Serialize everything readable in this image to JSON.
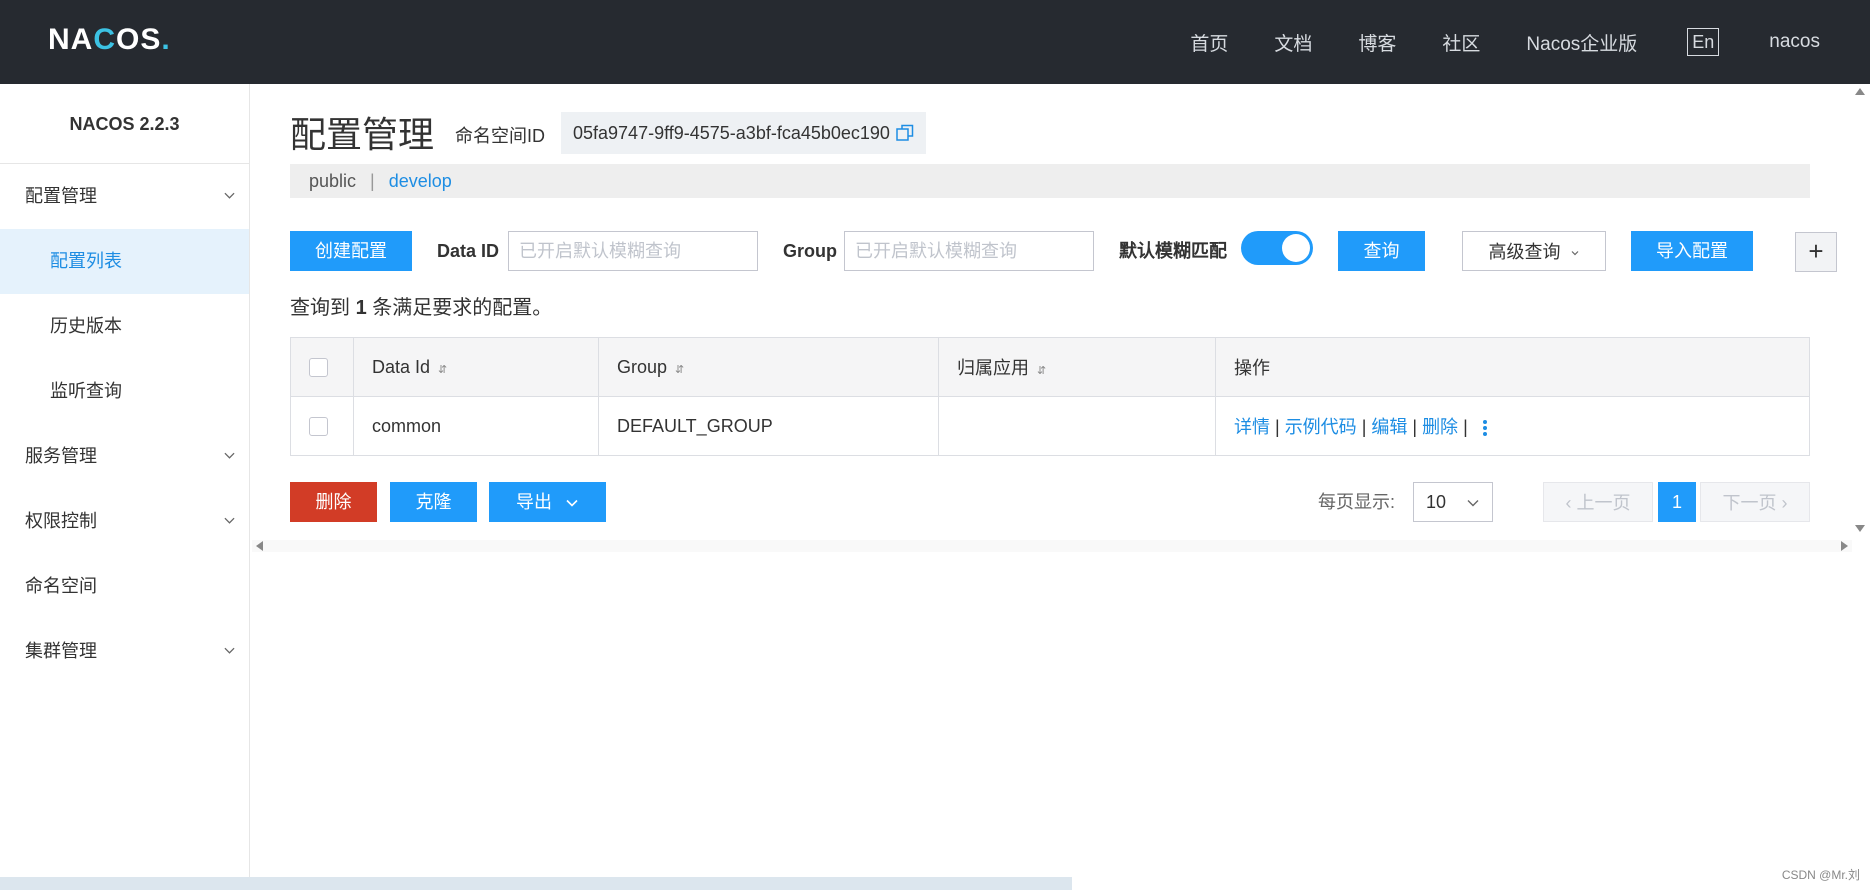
{
  "header": {
    "logo_text": "NACOS.",
    "nav": [
      "首页",
      "文档",
      "博客",
      "社区",
      "Nacos企业版"
    ],
    "lang": "En",
    "user": "nacos"
  },
  "sidebar": {
    "version": "NACOS 2.2.3",
    "items": [
      {
        "label": "配置管理",
        "expandable": true
      },
      {
        "label": "配置列表",
        "sub": true,
        "active": true
      },
      {
        "label": "历史版本",
        "sub": true
      },
      {
        "label": "监听查询",
        "sub": true
      },
      {
        "label": "服务管理",
        "expandable": true
      },
      {
        "label": "权限控制",
        "expandable": true
      },
      {
        "label": "命名空间"
      },
      {
        "label": "集群管理",
        "expandable": true
      }
    ]
  },
  "main": {
    "title": "配置管理",
    "namespace_label": "命名空间ID",
    "namespace_id": "05fa9747-9ff9-4575-a3bf-fca45b0ec190",
    "namespaces": [
      "public",
      "develop"
    ],
    "namespace_sep": "|",
    "toolbar": {
      "create_label": "创建配置",
      "dataid_label": "Data ID",
      "dataid_placeholder": "已开启默认模糊查询",
      "group_label": "Group",
      "group_placeholder": "已开启默认模糊查询",
      "fuzzy_label": "默认模糊匹配",
      "fuzzy_on": true,
      "search_label": "查询",
      "advanced_label": "高级查询",
      "import_label": "导入配置",
      "plus_label": "+"
    },
    "summary": {
      "prefix": "查询到",
      "count": "1",
      "suffix": "条满足要求的配置。"
    },
    "table": {
      "columns": [
        "Data Id",
        "Group",
        "归属应用",
        "操作"
      ],
      "rows": [
        {
          "data_id": "common",
          "group": "DEFAULT_GROUP",
          "app": "",
          "ops": [
            "详情",
            "示例代码",
            "编辑",
            "删除"
          ]
        }
      ],
      "op_sep": "|"
    },
    "footer": {
      "delete_label": "删除",
      "clone_label": "克隆",
      "export_label": "导出",
      "per_page_label": "每页显示:",
      "per_page_value": "10",
      "prev_label": "上一页",
      "current_page": "1",
      "next_label": "下一页"
    }
  },
  "colors": {
    "primary": "#209bfa",
    "danger": "#d23c26",
    "topbar": "#262a30",
    "link": "#1d8de3"
  },
  "watermark": "CSDN @Mr.刘"
}
